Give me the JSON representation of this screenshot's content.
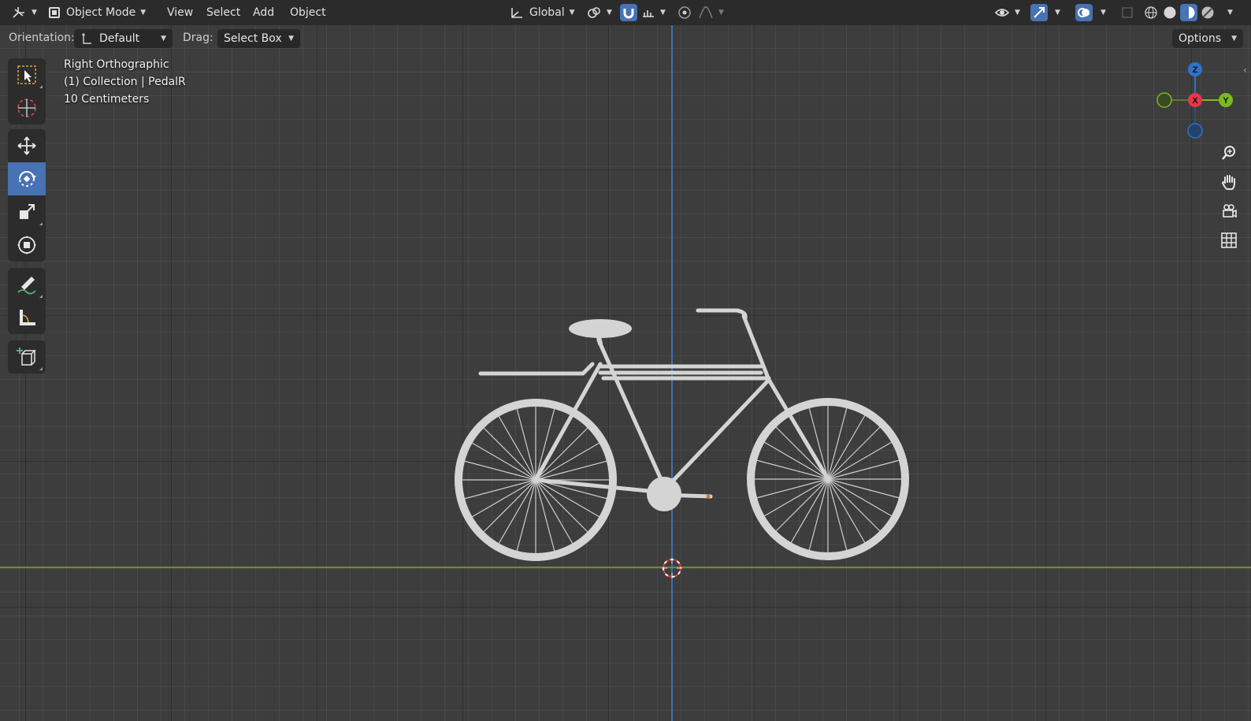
{
  "header": {
    "mode": "Object Mode",
    "menus": [
      "View",
      "Select",
      "Add",
      "Object"
    ],
    "transform_orientation": "Global"
  },
  "subheader": {
    "orientation_label": "Orientation:",
    "orientation_value": "Default",
    "drag_label": "Drag:",
    "drag_value": "Select Box",
    "options_label": "Options"
  },
  "viewport": {
    "view_name": "Right Orthographic",
    "collection_info": "(1) Collection | PedalR",
    "scale_info": "10 Centimeters"
  },
  "gizmo": {
    "z": "Z",
    "x": "X",
    "y": "Y"
  },
  "colors": {
    "accent": "#4772b3",
    "axis_x": "#e8344b",
    "axis_y": "#7cb81f",
    "axis_z": "#2f72c8",
    "model": "#d4d4d4"
  },
  "tools": [
    "select-box",
    "cursor",
    "move",
    "rotate",
    "scale",
    "transform",
    "annotate",
    "measure",
    "add-cube"
  ],
  "active_tool": "rotate"
}
